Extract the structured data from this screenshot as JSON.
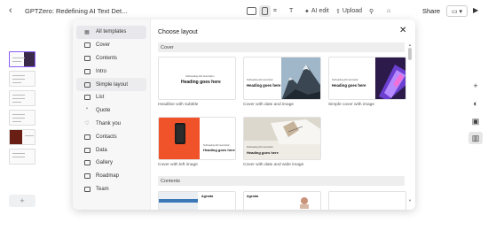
{
  "topbar": {
    "title": "GPTZero: Redefining AI Text Det...",
    "ai_edit": "AI edit",
    "upload": "Upload",
    "share": "Share",
    "sparkle_icon": "sparkle-icon",
    "upload_icon": "upload-icon"
  },
  "modal": {
    "title": "Choose layout",
    "categories": [
      {
        "label": "All templates",
        "icon": "layout-grid-icon"
      },
      {
        "label": "Cover",
        "icon": "cover-icon"
      },
      {
        "label": "Contents",
        "icon": "contents-icon"
      },
      {
        "label": "Intro",
        "icon": "intro-icon"
      },
      {
        "label": "Simple layout",
        "icon": "simple-layout-icon"
      },
      {
        "label": "List",
        "icon": "list-icon"
      },
      {
        "label": "Quote",
        "icon": "quote-icon"
      },
      {
        "label": "Thank you",
        "icon": "thank-you-icon"
      },
      {
        "label": "Contacts",
        "icon": "contacts-icon"
      },
      {
        "label": "Data",
        "icon": "data-icon"
      },
      {
        "label": "Gallery",
        "icon": "gallery-icon"
      },
      {
        "label": "Roadmap",
        "icon": "roadmap-icon"
      },
      {
        "label": "Team",
        "icon": "team-icon"
      }
    ],
    "sections": {
      "cover": "Cover",
      "contents": "Contents"
    },
    "cover_cards": [
      {
        "label": "Headline with subtitle",
        "sub": "Subheading with description",
        "heading": "Heading goes here"
      },
      {
        "label": "Cover with date and image",
        "sub": "Subheading with description",
        "heading": "Heading goes here"
      },
      {
        "label": "Simple cover with image",
        "sub": "Subheading with description",
        "heading": "Heading goes here"
      },
      {
        "label": "Cover with left image",
        "sub": "Subheading with description",
        "heading": "Heading goes here"
      },
      {
        "label": "Cover with date and wide image",
        "sub": "Subheading with description",
        "heading": "Heading goes here"
      }
    ],
    "contents_cards": [
      {
        "heading": "Agenda"
      },
      {
        "heading": "Agenda"
      },
      {
        "heading": ""
      }
    ]
  },
  "colors": {
    "accent": "#8b5cf6",
    "orange": "#f0522a",
    "purple_dark": "#2c1a4a"
  }
}
